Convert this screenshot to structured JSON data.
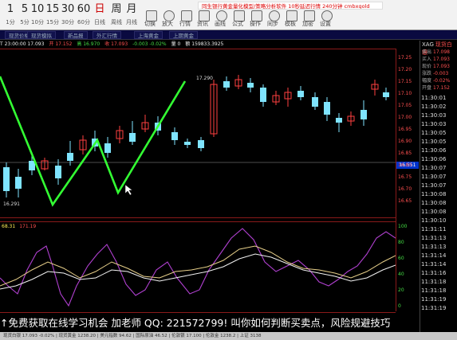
{
  "toolbar": {
    "periods": [
      {
        "big": "1",
        "small": "1分"
      },
      {
        "big": "5",
        "small": "5分"
      },
      {
        "big": "10",
        "small": "10分"
      },
      {
        "big": "15",
        "small": "15分"
      },
      {
        "big": "30",
        "small": "30分"
      },
      {
        "big": "60",
        "small": "60分"
      },
      {
        "big": "日",
        "small": "日线"
      },
      {
        "big": "周",
        "small": "周线"
      },
      {
        "big": "月",
        "small": "月线"
      }
    ],
    "tools": [
      "切换",
      "放大",
      "行情",
      "资讯",
      "画线",
      "公式",
      "操作",
      "同步",
      "模板",
      "加密",
      "设置"
    ],
    "notice": "同生银行黄金量化模型/策略分析软件 10秒延迟行情 240分钟 cmbxgold"
  },
  "tabs": [
    "现货价格",
    "现货模拟",
    "新品报",
    "外汇行情",
    "上海黄金",
    "上期黄金"
  ],
  "infobar": {
    "items": [
      {
        "text": "T 23:00:00 17.093",
        "color": "white"
      },
      {
        "text": "开 17.152",
        "color": "red"
      },
      {
        "text": "高 16.970",
        "color": "green"
      },
      {
        "text": "收 17.093",
        "color": "red"
      },
      {
        "text": "-0.003  -0.02%",
        "color": "green"
      },
      {
        "text": "量 0",
        "color": "white"
      },
      {
        "text": "额 159833.3925",
        "color": "white"
      }
    ]
  },
  "main_chart": {
    "high_label": "17.290",
    "low_label": "16.291"
  },
  "osc_chart": {
    "header": [
      {
        "text": "68.31",
        "color": "yellow"
      },
      {
        "text": "171.19",
        "color": "red"
      }
    ]
  },
  "price_axis": {
    "ticks": [
      "17.25",
      "17.20",
      "17.15",
      "17.10",
      "17.05",
      "17.00",
      "16.95",
      "16.90",
      "16.85",
      "16.80",
      "16.75",
      "16.70",
      "16.65"
    ],
    "current": "16.551",
    "osc_ticks": [
      "100",
      "80",
      "60",
      "40",
      "20",
      "0"
    ]
  },
  "right_panel": {
    "symbol": "XAG",
    "name": "现货白银",
    "quote": [
      {
        "k": "卖出",
        "v": "17.098"
      },
      {
        "k": "买入",
        "v": "17.093"
      },
      {
        "k": "现价",
        "v": "17.093"
      },
      {
        "k": "涨跌",
        "v": "-0.003"
      },
      {
        "k": "幅度",
        "v": "-0.02%"
      },
      {
        "k": "开盘",
        "v": "17.152"
      }
    ],
    "times": [
      "11:30:01",
      "11:30:02",
      "11:30:03",
      "11:30:03",
      "11:30:05",
      "11:30:05",
      "11:30:06",
      "11:30:06",
      "11:30:07",
      "11:30:07",
      "11:30:07",
      "11:30:08",
      "11:30:08",
      "11:30:08",
      "11:30:10",
      "11:31:11",
      "11:31:13",
      "11:31:13",
      "11:31:14",
      "11:31:14",
      "11:31:16",
      "11:31:18",
      "11:31:18",
      "11:31:19",
      "11:31:19"
    ]
  },
  "subtitle": "↑免费获取在线学习机会 加老师 QQ: 221572799! 叫你如何判断买卖点，风险规避技巧",
  "statusbar": "现货白银 17.093 -0.02% | 现货黄金 1238.20 | 美元指数 94.62 | 国际原油 46.52 | 伦敦银 17.100 | 伦敦金 1238.2 | 上证 3138"
}
